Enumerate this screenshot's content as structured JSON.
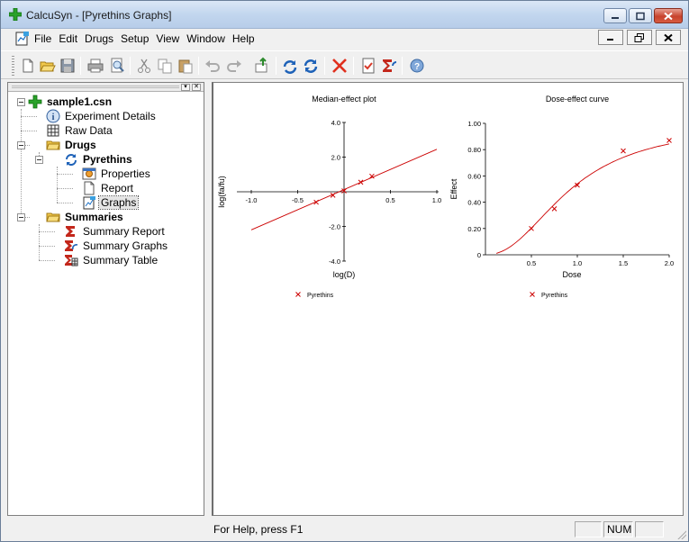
{
  "window": {
    "title": "CalcuSyn - [Pyrethins Graphs]"
  },
  "menu": {
    "items": [
      "File",
      "Edit",
      "Drugs",
      "Setup",
      "View",
      "Window",
      "Help"
    ]
  },
  "toolbar": {
    "buttons": [
      "new-icon",
      "open-icon",
      "save-icon",
      "print-icon",
      "print-preview-icon",
      "cut-icon",
      "copy-icon",
      "paste-icon",
      "undo-icon",
      "redo-icon",
      "export-icon",
      "refresh-icon",
      "reload-icon",
      "delete-icon",
      "report-icon",
      "summary-icon",
      "help-icon"
    ]
  },
  "tree": {
    "root": "sample1.csn",
    "experiment_details": "Experiment Details",
    "raw_data": "Raw Data",
    "drugs": "Drugs",
    "drug": "Pyrethins",
    "properties": "Properties",
    "report": "Report",
    "graphs": "Graphs",
    "summaries": "Summaries",
    "summary_report": "Summary Report",
    "summary_graphs": "Summary Graphs",
    "summary_table": "Summary Table"
  },
  "chart_data": [
    {
      "type": "scatter",
      "title": "Median-effect plot",
      "xlabel": "log(D)",
      "ylabel": "log(fa/fu)",
      "xlim": [
        -1.0,
        1.0
      ],
      "ylim": [
        -4.0,
        4.0
      ],
      "xticks": [
        "-1.0",
        "-0.5",
        "0.5",
        "1.0"
      ],
      "yticks": [
        "4.0",
        "2.0",
        "-2.0",
        "-4.0"
      ],
      "series": [
        {
          "name": "Pyrethins",
          "points": [
            [
              -0.3,
              -0.6
            ],
            [
              -0.12,
              -0.2
            ],
            [
              0.0,
              0.05
            ],
            [
              0.18,
              0.55
            ],
            [
              0.3,
              0.9
            ]
          ]
        }
      ],
      "fit_line": [
        [
          -1.0,
          -2.2
        ],
        [
          1.0,
          2.45
        ]
      ],
      "legend": "Pyrethins",
      "color": "#cc0000"
    },
    {
      "type": "scatter",
      "title": "Dose-effect curve",
      "xlabel": "Dose",
      "ylabel": "Effect",
      "xlim": [
        0,
        2.0
      ],
      "ylim": [
        0,
        1.0
      ],
      "xticks": [
        "0.5",
        "1.0",
        "1.5",
        "2.0"
      ],
      "yticks": [
        "1.00",
        "0.80",
        "0.60",
        "0.40",
        "0.20",
        "0"
      ],
      "series": [
        {
          "name": "Pyrethins",
          "points": [
            [
              0.5,
              0.2
            ],
            [
              0.75,
              0.35
            ],
            [
              1.0,
              0.53
            ],
            [
              1.5,
              0.79
            ],
            [
              2.0,
              0.87
            ]
          ]
        }
      ],
      "curve": {
        "dm": 0.93,
        "m": 2.2
      },
      "legend": "Pyrethins",
      "color": "#cc0000"
    }
  ],
  "status": {
    "help": "For Help, press F1",
    "num": "NUM"
  }
}
